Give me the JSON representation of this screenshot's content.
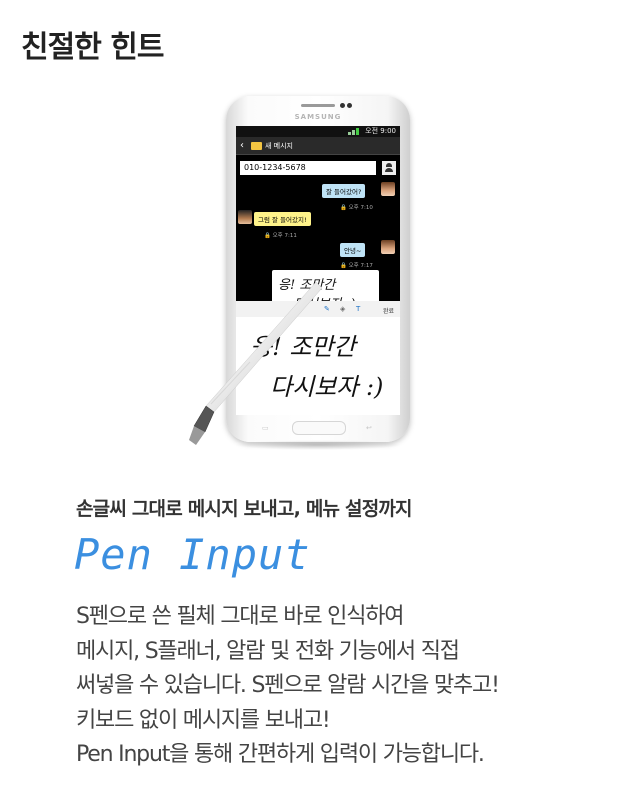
{
  "page": {
    "title": "친절한 힌트"
  },
  "phone": {
    "brand": "SAMSUNG",
    "status_time": "오전 9:00",
    "app_title": "새 메시지",
    "recipient_number": "010-1234-5678",
    "messages": [
      {
        "text": "잘 들어갔어?",
        "time": "오후 7:10",
        "side": "out"
      },
      {
        "text": "그럼 잘 들어갔지!",
        "time": "오후 7:11",
        "side": "in"
      },
      {
        "text": "안녕~",
        "time": "오후 7:17",
        "side": "out"
      }
    ],
    "handwriting_lines": [
      "응! 조만간",
      "다시보자 :)"
    ],
    "pen_toolbar": {
      "text_tool": "T",
      "done_label": "완료"
    },
    "softkey_menu": "▭",
    "softkey_back": "↩"
  },
  "content": {
    "subtitle": "손글씨 그대로 메시지 보내고, 메뉴 설정까지",
    "feature_name": "Pen Input",
    "description_lines": [
      "S펜으로 쓴 필체 그대로 바로 인식하여",
      "메시지, S플래너, 알람 및 전화 기능에서 직접",
      "써넣을 수 있습니다. S펜으로 알람 시간을 맞추고!",
      "키보드 없이 메시지를 보내고!",
      "Pen Input을 통해 간편하게 입력이 가능합니다."
    ]
  },
  "colors": {
    "accent_blue": "#3b8fe0",
    "bubble_out": "#bfe3f6",
    "bubble_in": "#fff38a"
  }
}
